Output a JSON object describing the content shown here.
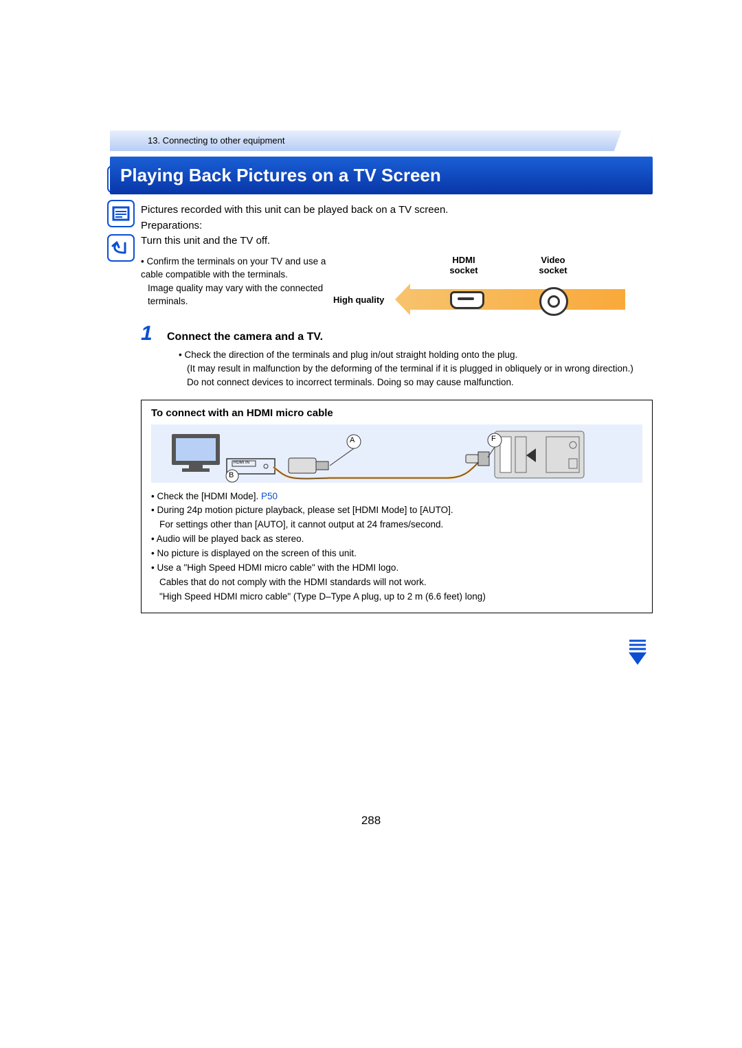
{
  "breadcrumb": "13. Connecting to other equipment",
  "title": "Playing Back Pictures on a TV Screen",
  "intro_line": "Pictures recorded with this unit can be played back on a TV screen.",
  "prep_label": "Preparations:",
  "prep_text": "Turn this unit and the TV off.",
  "terminals": {
    "bullet1a": "• Confirm the terminals on your TV and use a cable compatible with the terminals.",
    "bullet1b": "Image quality may vary with the connected terminals.",
    "high_quality": "High quality",
    "hdmi_label_1": "HDMI",
    "hdmi_label_2": "socket",
    "video_label_1": "Video",
    "video_label_2": "socket"
  },
  "step": {
    "num": "1",
    "title": "Connect the camera and a TV.",
    "b1": "• Check the direction of the terminals and plug in/out straight holding onto the plug.",
    "b1s1": "(It may result in malfunction by the deforming of the terminal if it is plugged in obliquely or in wrong direction.)",
    "b1s2": "Do not connect devices to incorrect terminals. Doing so may cause malfunction."
  },
  "conn": {
    "title": "To connect with an HDMI micro cable",
    "labelA": "A",
    "labelB": "B",
    "labelF": "F",
    "hdmi_in": "HDMI IN",
    "b1": "• Check the [HDMI Mode]. ",
    "b1_link": "P50",
    "b2": "• During 24p motion picture playback, please set [HDMI Mode] to [AUTO].",
    "b2s": "For settings other than [AUTO], it cannot output at 24 frames/second.",
    "b3": "• Audio will be played back as stereo.",
    "b4": "• No picture is displayed on the screen of this unit.",
    "b5": "• Use a \"High Speed HDMI micro cable\" with the HDMI logo.",
    "b5s": "Cables that do not comply with the HDMI standards will not work.",
    "b5s2": "\"High Speed HDMI micro cable\" (Type D–Type A plug, up to 2 m (6.6 feet) long)"
  },
  "page_number": "288"
}
